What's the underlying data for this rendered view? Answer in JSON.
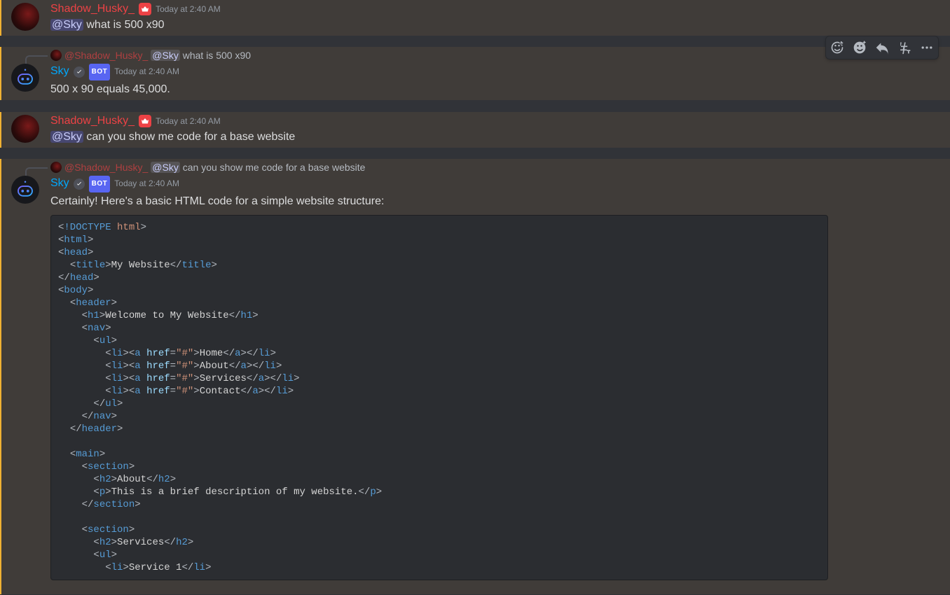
{
  "users": {
    "shadow": "Shadow_Husky_",
    "sky": "Sky"
  },
  "bot_tag": "BOT",
  "timestamps": {
    "m1": "Today at 2:40 AM",
    "m2": "Today at 2:40 AM",
    "m3": "Today at 2:40 AM",
    "m4": "Today at 2:40 AM"
  },
  "mentions": {
    "sky": "@Sky",
    "shadow": "@Shadow_Husky_"
  },
  "msg1": {
    "text_after_mention": " what is 500 x90"
  },
  "reply1": {
    "text_after_mention": " what is 500 x90"
  },
  "msg2": {
    "content": "500 x 90 equals 45,000."
  },
  "msg3": {
    "text_after_mention": " can you show me code for a base website"
  },
  "reply2": {
    "text_after_mention": " can you show me code for a base website"
  },
  "msg4": {
    "intro": "Certainly! Here's a basic HTML code for a simple website structure:"
  },
  "code": {
    "doctype_kw": "!DOCTYPE",
    "doctype_val": "html",
    "tag_html": "html",
    "tag_head": "head",
    "tag_title": "title",
    "title_text": "My Website",
    "tag_body": "body",
    "tag_header": "header",
    "tag_h1": "h1",
    "h1_text": "Welcome to My Website",
    "tag_nav": "nav",
    "tag_ul": "ul",
    "tag_li": "li",
    "tag_a": "a",
    "attr_href": "href",
    "href_val": "\"#\"",
    "nav_items": [
      "Home",
      "About",
      "Services",
      "Contact"
    ],
    "tag_main": "main",
    "tag_section": "section",
    "tag_h2": "h2",
    "tag_p": "p",
    "about_h2": "About",
    "about_p": "This is a brief description of my website.",
    "services_h2": "Services",
    "service_items": [
      "Service 1"
    ]
  },
  "actions": {
    "react": "add-reaction-icon",
    "superreact": "super-reaction-icon",
    "reply": "reply-icon",
    "thread": "create-thread-icon",
    "more": "more-icon"
  }
}
